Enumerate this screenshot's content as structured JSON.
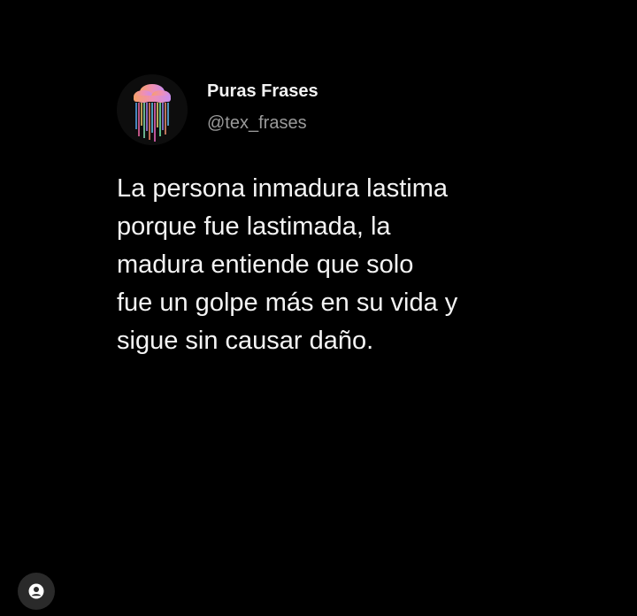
{
  "post": {
    "display_name": "Puras Frases",
    "handle": "@tex_frases",
    "text": "La persona inmadura lastima\nporque fue lastimada, la\nmadura entiende que solo\nfue un golpe más en su vida y\nsigue sin causar daño.",
    "avatar_icon": "rain-cloud-icon"
  },
  "overlay": {
    "account_icon": "user-icon"
  },
  "colors": {
    "background": "#000000",
    "text": "#f4f4f4",
    "handle": "#9a9a9a",
    "overlay_button": "#2a2a2a"
  }
}
